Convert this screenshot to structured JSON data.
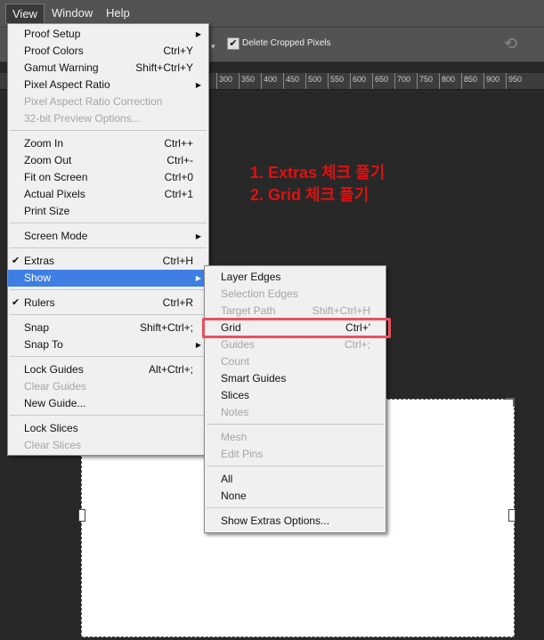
{
  "menubar": {
    "items": [
      "View",
      "Window",
      "Help"
    ]
  },
  "options_bar": {
    "checkbox_checked": true,
    "checkbox_label": "Delete Cropped Pixels"
  },
  "ruler": {
    "labels": [
      "300",
      "350",
      "400",
      "450",
      "500",
      "550",
      "600",
      "650",
      "700",
      "750",
      "800",
      "850",
      "900",
      "950"
    ]
  },
  "annotation": {
    "line1": "1. Extras 체크 풀기",
    "line2": "2. Grid 체크 풀기"
  },
  "view_menu": {
    "items": [
      {
        "label": "Proof Setup",
        "shortcut": "",
        "submenu": true,
        "disabled": false
      },
      {
        "label": "Proof Colors",
        "shortcut": "Ctrl+Y",
        "disabled": false
      },
      {
        "label": "Gamut Warning",
        "shortcut": "Shift+Ctrl+Y",
        "disabled": false
      },
      {
        "label": "Pixel Aspect Ratio",
        "shortcut": "",
        "submenu": true,
        "disabled": false
      },
      {
        "label": "Pixel Aspect Ratio Correction",
        "shortcut": "",
        "disabled": true
      },
      {
        "label": "32-bit Preview Options...",
        "shortcut": "",
        "disabled": true
      },
      {
        "label": "Zoom In",
        "shortcut": "Ctrl++",
        "disabled": false
      },
      {
        "label": "Zoom Out",
        "shortcut": "Ctrl+-",
        "disabled": false
      },
      {
        "label": "Fit on Screen",
        "shortcut": "Ctrl+0",
        "disabled": false
      },
      {
        "label": "Actual Pixels",
        "shortcut": "Ctrl+1",
        "disabled": false
      },
      {
        "label": "Print Size",
        "shortcut": "",
        "disabled": false
      },
      {
        "label": "Screen Mode",
        "shortcut": "",
        "submenu": true,
        "disabled": false
      },
      {
        "label": "Extras",
        "shortcut": "Ctrl+H",
        "checked": true,
        "disabled": false
      },
      {
        "label": "Show",
        "shortcut": "",
        "submenu": true,
        "highlighted": true,
        "disabled": false
      },
      {
        "label": "Rulers",
        "shortcut": "Ctrl+R",
        "checked": true,
        "disabled": false
      },
      {
        "label": "Snap",
        "shortcut": "Shift+Ctrl+;",
        "disabled": false
      },
      {
        "label": "Snap To",
        "shortcut": "",
        "submenu": true,
        "disabled": false
      },
      {
        "label": "Lock Guides",
        "shortcut": "Alt+Ctrl+;",
        "disabled": false
      },
      {
        "label": "Clear Guides",
        "shortcut": "",
        "disabled": true
      },
      {
        "label": "New Guide...",
        "shortcut": "",
        "disabled": false
      },
      {
        "label": "Lock Slices",
        "shortcut": "",
        "disabled": false
      },
      {
        "label": "Clear Slices",
        "shortcut": "",
        "disabled": true
      }
    ]
  },
  "show_menu": {
    "items": [
      {
        "label": "Layer Edges",
        "shortcut": "",
        "disabled": false
      },
      {
        "label": "Selection Edges",
        "shortcut": "",
        "disabled": true
      },
      {
        "label": "Target Path",
        "shortcut": "Shift+Ctrl+H",
        "disabled": true
      },
      {
        "label": "Grid",
        "shortcut": "Ctrl+'",
        "disabled": false
      },
      {
        "label": "Guides",
        "shortcut": "Ctrl+;",
        "disabled": true
      },
      {
        "label": "Count",
        "shortcut": "",
        "disabled": true
      },
      {
        "label": "Smart Guides",
        "shortcut": "",
        "disabled": false
      },
      {
        "label": "Slices",
        "shortcut": "",
        "disabled": false
      },
      {
        "label": "Notes",
        "shortcut": "",
        "disabled": true
      },
      {
        "label": "Mesh",
        "shortcut": "",
        "disabled": true
      },
      {
        "label": "Edit Pins",
        "shortcut": "",
        "disabled": true
      },
      {
        "label": "All",
        "shortcut": "",
        "disabled": false
      },
      {
        "label": "None",
        "shortcut": "",
        "disabled": false
      },
      {
        "label": "Show Extras Options...",
        "shortcut": "",
        "disabled": false
      }
    ]
  },
  "colors": {
    "highlight": "#3f7fe4",
    "annotation": "#e01010",
    "callout_box": "#e8505d"
  }
}
